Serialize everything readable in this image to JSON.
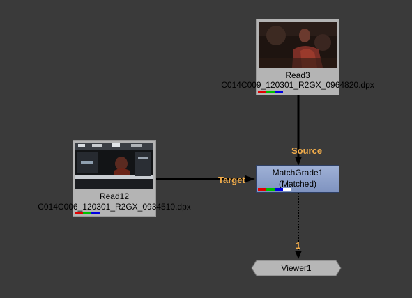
{
  "nodes": {
    "read3": {
      "name": "Read3",
      "file": "C014C009_120301_R2GX_0964820.dpx",
      "channels": [
        "#e00000",
        "#00c000",
        "#0000e0"
      ]
    },
    "read12": {
      "name": "Read12",
      "file": "C014C006_120301_R2GX_0934510.dpx",
      "channels": [
        "#e00000",
        "#00c000",
        "#0000e0"
      ]
    },
    "matchgrade": {
      "name": "MatchGrade1",
      "status": "(Matched)",
      "channels": [
        "#e00000",
        "#00c000",
        "#0000e0",
        "#ffffff"
      ]
    },
    "viewer": {
      "name": "Viewer1"
    }
  },
  "inputs": {
    "source": "Source",
    "target": "Target",
    "viewer_input": "1"
  },
  "colors": {
    "background": "#3a3a3a",
    "input_label": "#f2ad4b",
    "grade_node": "#8fa3cf",
    "read_node": "#b4b4b4"
  }
}
